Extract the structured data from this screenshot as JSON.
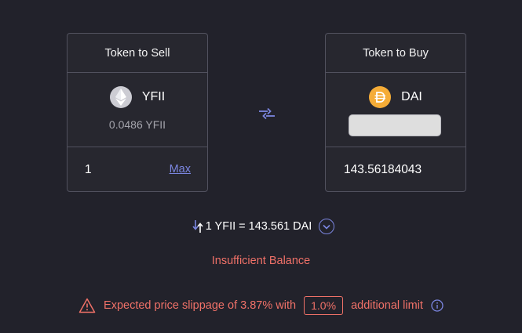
{
  "sell_card": {
    "title": "Token to Sell",
    "token": "YFII",
    "token_icon": "ethereum-icon",
    "balance": "0.0486 YFII",
    "amount": "1",
    "max_label": "Max"
  },
  "buy_card": {
    "title": "Token to Buy",
    "token": "DAI",
    "token_icon": "dai-icon",
    "amount": "143.56184043"
  },
  "swap_icon": "swap-arrows-icon",
  "rate": {
    "text": "1 YFII = 143.561 DAI",
    "icon": "swap-vertical-icon",
    "toggle_icon": "chevron-down-circle-icon"
  },
  "error": "Insufficient Balance",
  "slippage": {
    "prefix": "Expected price slippage of 3.87% with",
    "limit": "1.0%",
    "suffix": "additional limit",
    "warning_icon": "warning-icon",
    "info_icon": "info-icon"
  },
  "colors": {
    "background": "#22222b",
    "card_border": "#51515e",
    "accent": "#7b86e0",
    "error": "#f07168",
    "dai": "#f5ac37"
  }
}
